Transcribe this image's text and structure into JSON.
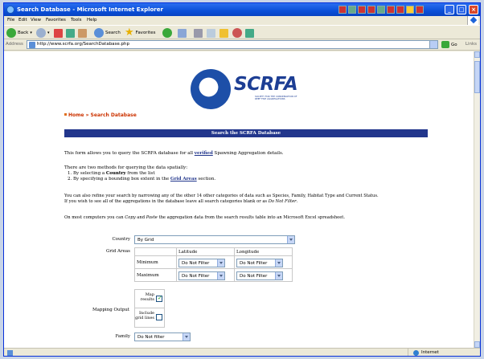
{
  "window": {
    "title": "Search Database - Microsoft Internet Explorer"
  },
  "menubar": {
    "items": [
      "File",
      "Edit",
      "View",
      "Favorites",
      "Tools",
      "Help"
    ]
  },
  "toolbar": {
    "back_label": "Back",
    "search_label": "Search",
    "favorites_label": "Favorites"
  },
  "addressbar": {
    "label": "Address",
    "url": "http://www.scrfa.org/SearchDatabase.php",
    "go_label": "Go",
    "links_label": "Links"
  },
  "statusbar": {
    "zone_label": "Internet"
  },
  "page": {
    "logo": {
      "wordmark": "SCRFA",
      "tagline": "SOCIETY FOR THE CONSERVATION OF REEF FISH AGGREGATIONS"
    },
    "breadcrumb": {
      "home": "Home",
      "separator": "»",
      "current": "Search Database"
    },
    "banner": "Search the SCRFA Database",
    "intro": {
      "pre": "This form allows you to query the SCRFA database for all ",
      "link": "verified",
      "post": " Spawning Aggregation details."
    },
    "methods": {
      "heading": "There are two methods for querying the data spatially:",
      "m1_pre": "1. By selecting a ",
      "m1_bold": "Country",
      "m1_post": " from the list",
      "m2_pre": "2. By specifying a bounding box extent in the ",
      "m2_link": "Grid Areas",
      "m2_post": " section."
    },
    "refine": {
      "line1": "You can also refine your search by narrowing any of the other 14 other categories of data such as Species, Family, Habitat Type and Current Status.",
      "line2_pre": "If you wish to see all of the aggregations in the database leave all search categories blank or as ",
      "line2_em": "Do Not Filter",
      "line2_post": "."
    },
    "copy": {
      "pre": "On most computers you can ",
      "em1": "Copy",
      "mid": " and ",
      "em2": "Paste",
      "post": " the aggregation data from the search results table into an Microsoft Excel spreadsheet."
    },
    "form": {
      "country_label": "Country",
      "country_value": "By Grid",
      "grid_label": "Grid Areas",
      "lat_header": "Latitude",
      "lon_header": "Longitude",
      "minimum_label": "Minimum",
      "maximum_label": "Maximum",
      "min_lat": "Do Not Filter",
      "min_lon": "Do Not Filter",
      "max_lat": "Do Not Filter",
      "max_lon": "Do Not Filter",
      "mapping_label": "Mapping Output",
      "map_results_label": "Map results",
      "map_results_checked": true,
      "grid_lines_label": "Include grid lines",
      "grid_lines_checked": false,
      "family_label": "Family",
      "family_value": "Do Not filter"
    }
  }
}
